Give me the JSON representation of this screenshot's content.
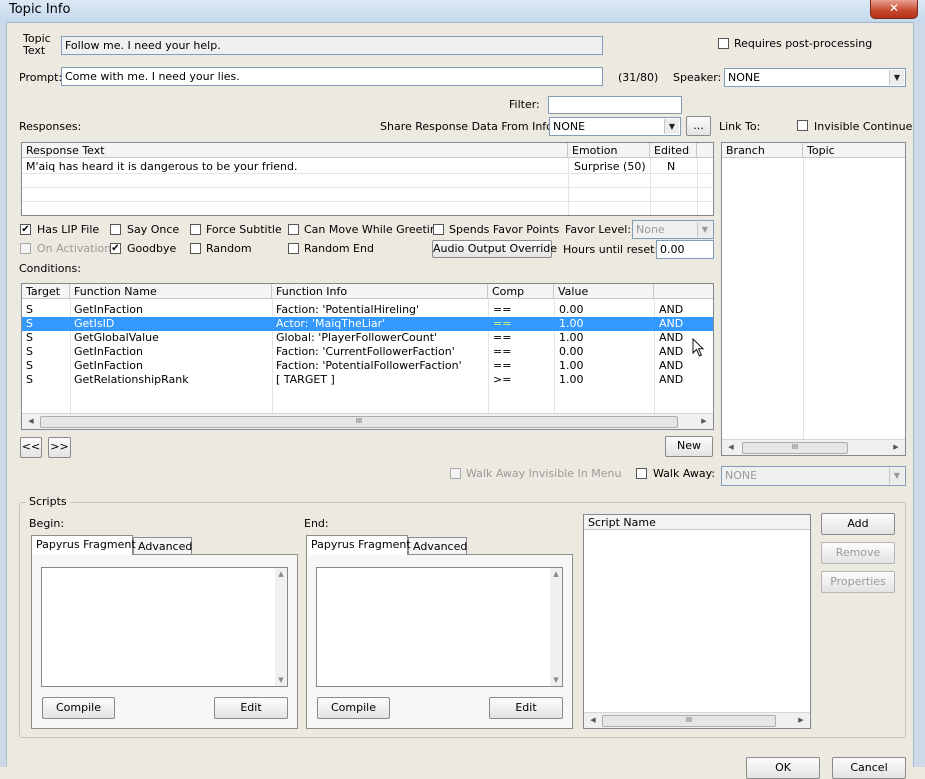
{
  "window": {
    "title": "Topic Info",
    "close_glyph": "✕"
  },
  "topic": {
    "label": "Topic\nText",
    "value": "Follow me. I need your help.",
    "requires_post_processing": "Requires post-processing"
  },
  "prompt": {
    "label": "Prompt:",
    "value": "Come with me. I need your lies.",
    "count": "(31/80)"
  },
  "speaker": {
    "label": "Speaker:",
    "value": "NONE"
  },
  "filter": {
    "label": "Filter:",
    "value": ""
  },
  "responses": {
    "label": "Responses:",
    "share_label": "Share Response Data From Info:",
    "share_value": "NONE",
    "ellipsis_button": "...",
    "columns": [
      "Response Text",
      "Emotion",
      "Edited"
    ],
    "rows": [
      {
        "text": "M'aiq has heard it is dangerous to be your friend.",
        "emotion": "Surprise (50)",
        "edited": "N"
      }
    ]
  },
  "link_to": {
    "label": "Link To:",
    "invisible_continue": "Invisible Continue",
    "columns": [
      "Branch",
      "Topic"
    ],
    "scroll_grip": "III"
  },
  "options": {
    "has_lip_file": "Has LIP File",
    "say_once": "Say Once",
    "force_subtitle": "Force Subtitle",
    "can_move_while_greeting": "Can Move While Greeting",
    "spends_favor_points": "Spends Favor Points",
    "favor_level_label": "Favor Level:",
    "favor_level_value": "None",
    "on_activation": "On Activation",
    "goodbye": "Goodbye",
    "random": "Random",
    "random_end": "Random End",
    "audio_output_override": "Audio Output Override",
    "hours_until_reset_label": "Hours until reset:",
    "hours_until_reset_value": "0.00",
    "check_glyph": "✔"
  },
  "conditions": {
    "label": "Conditions:",
    "columns": [
      "Target",
      "Function Name",
      "Function Info",
      "Comp",
      "Value",
      ""
    ],
    "rows": [
      {
        "target": "S",
        "function": "GetInFaction",
        "info": "Faction: 'PotentialHireling'",
        "comp": "==",
        "value": "0.00",
        "op": "AND"
      },
      {
        "target": "S",
        "function": "GetIsID",
        "info": "Actor: 'MaiqTheLiar'",
        "comp": "==",
        "value": "1.00",
        "op": "AND"
      },
      {
        "target": "S",
        "function": "GetGlobalValue",
        "info": "Global: 'PlayerFollowerCount'",
        "comp": "==",
        "value": "1.00",
        "op": "AND"
      },
      {
        "target": "S",
        "function": "GetInFaction",
        "info": "Faction: 'CurrentFollowerFaction'",
        "comp": "==",
        "value": "0.00",
        "op": "AND"
      },
      {
        "target": "S",
        "function": "GetInFaction",
        "info": "Faction: 'PotentialFollowerFaction'",
        "comp": "==",
        "value": "1.00",
        "op": "AND"
      },
      {
        "target": "S",
        "function": "GetRelationshipRank",
        "info": "[ TARGET ]",
        "comp": ">=",
        "value": "1.00",
        "op": "AND"
      }
    ],
    "prev_button": "<<",
    "next_button": ">>",
    "new_button": "New",
    "scroll_grip": "III"
  },
  "walk_away": {
    "invisible_in_menu": "Walk Away Invisible In Menu",
    "label": "Walk Away:",
    "value": "NONE"
  },
  "scripts": {
    "group_label": "Scripts",
    "begin_label": "Begin:",
    "end_label": "End:",
    "tab_fragment": "Papyrus Fragment",
    "tab_advanced": "Advanced",
    "compile_button": "Compile",
    "edit_button": "Edit",
    "script_name_header": "Script Name",
    "add_button": "Add",
    "remove_button": "Remove",
    "properties_button": "Properties",
    "scroll_grip": "III"
  },
  "footer": {
    "ok_button": "OK",
    "cancel_button": "Cancel"
  },
  "icons": {
    "arrow_down": "▼",
    "arrow_up": "▲",
    "arrow_left": "◀",
    "arrow_right": "▶",
    "cursor": "cursor-arrow-icon"
  }
}
